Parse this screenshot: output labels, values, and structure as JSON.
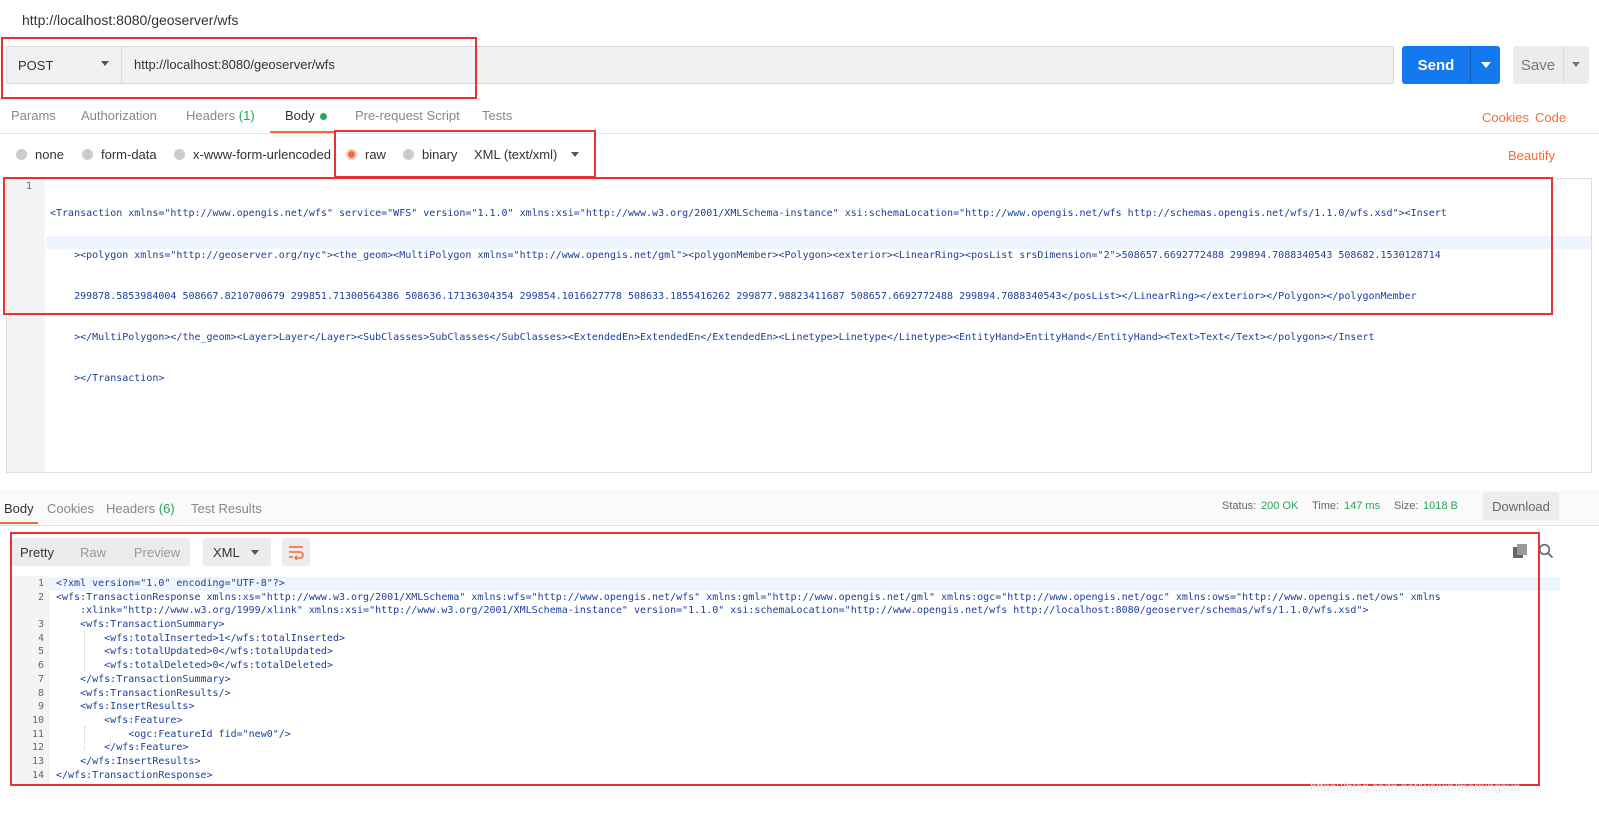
{
  "window": {
    "title": "http://localhost:8080/geoserver/wfs"
  },
  "request": {
    "method": "POST",
    "url": "http://localhost:8080/geoserver/wfs",
    "send_label": "Send",
    "save_label": "Save"
  },
  "request_tabs": [
    {
      "label": "Params"
    },
    {
      "label": "Authorization"
    },
    {
      "label": "Headers",
      "count": "(1)"
    },
    {
      "label": "Body"
    },
    {
      "label": "Pre-request Script"
    },
    {
      "label": "Tests"
    }
  ],
  "links": {
    "cookies": "Cookies",
    "code": "Code",
    "beautify": "Beautify"
  },
  "body_modes": {
    "none": "none",
    "form_data": "form-data",
    "urlencoded": "x-www-form-urlencoded",
    "raw": "raw",
    "binary": "binary",
    "content_type": "XML (text/xml)"
  },
  "request_body": {
    "line_number": "1",
    "lines": [
      "<Transaction xmlns=\"http://www.opengis.net/wfs\" service=\"WFS\" version=\"1.1.0\" xmlns:xsi=\"http://www.w3.org/2001/XMLSchema-instance\" xsi:schemaLocation=\"http://www.opengis.net/wfs http://schemas.opengis.net/wfs/1.1.0/wfs.xsd\"><Insert",
      "    ><polygon xmlns=\"http://geoserver.org/nyc\"><the_geom><MultiPolygon xmlns=\"http://www.opengis.net/gml\"><polygonMember><Polygon><exterior><LinearRing><posList srsDimension=\"2\">508657.6692772488 299894.7088340543 508682.1530128714",
      "    299878.5853984004 508667.8210700679 299851.71300564386 508636.17136304354 299854.1016627778 508633.1855416262 299877.98823411687 508657.6692772488 299894.7088340543</posList></LinearRing></exterior></Polygon></polygonMember",
      "    ></MultiPolygon></the_geom><Layer>Layer</Layer><SubClasses>SubClasses</SubClasses><ExtendedEn>ExtendedEn</ExtendedEn><Linetype>Linetype</Linetype><EntityHand>EntityHand</EntityHand><Text>Text</Text></polygon></Insert",
      "    ></Transaction>"
    ]
  },
  "response_tabs": [
    {
      "label": "Body"
    },
    {
      "label": "Cookies"
    },
    {
      "label": "Headers",
      "count": "(6)"
    },
    {
      "label": "Test Results"
    }
  ],
  "status": {
    "status_label": "Status:",
    "status_value": "200 OK",
    "time_label": "Time:",
    "time_value": "147 ms",
    "size_label": "Size:",
    "size_value": "1018 B",
    "download_label": "Download"
  },
  "response_formats": {
    "pretty": "Pretty",
    "raw": "Raw",
    "preview": "Preview",
    "type": "XML"
  },
  "response_body": [
    {
      "n": "1",
      "text": "<?xml version=\"1.0\" encoding=\"UTF-8\"?>"
    },
    {
      "n": "2",
      "text": "<wfs:TransactionResponse xmlns:xs=\"http://www.w3.org/2001/XMLSchema\" xmlns:wfs=\"http://www.opengis.net/wfs\" xmlns:gml=\"http://www.opengis.net/gml\" xmlns:ogc=\"http://www.opengis.net/ogc\" xmlns:ows=\"http://www.opengis.net/ows\" xmlns"
    },
    {
      "n": "",
      "text": "    :xlink=\"http://www.w3.org/1999/xlink\" xmlns:xsi=\"http://www.w3.org/2001/XMLSchema-instance\" version=\"1.1.0\" xsi:schemaLocation=\"http://www.opengis.net/wfs http://localhost:8080/geoserver/schemas/wfs/1.1.0/wfs.xsd\">"
    },
    {
      "n": "3",
      "text": "    <wfs:TransactionSummary>"
    },
    {
      "n": "4",
      "text": "        <wfs:totalInserted>1</wfs:totalInserted>"
    },
    {
      "n": "5",
      "text": "        <wfs:totalUpdated>0</wfs:totalUpdated>"
    },
    {
      "n": "6",
      "text": "        <wfs:totalDeleted>0</wfs:totalDeleted>"
    },
    {
      "n": "7",
      "text": "    </wfs:TransactionSummary>"
    },
    {
      "n": "8",
      "text": "    <wfs:TransactionResults/>"
    },
    {
      "n": "9",
      "text": "    <wfs:InsertResults>"
    },
    {
      "n": "10",
      "text": "        <wfs:Feature>"
    },
    {
      "n": "11",
      "text": "            <ogc:FeatureId fid=\"new0\"/>"
    },
    {
      "n": "12",
      "text": "        </wfs:Feature>"
    },
    {
      "n": "13",
      "text": "    </wfs:InsertResults>"
    },
    {
      "n": "14",
      "text": "</wfs:TransactionResponse>"
    }
  ],
  "watermark": "https://blog.csdn.net/weixin/morningsun",
  "colors": {
    "accent": "#f26b3a",
    "primary": "#1478ee",
    "success": "#26a65b",
    "highlight": "#e63232"
  }
}
